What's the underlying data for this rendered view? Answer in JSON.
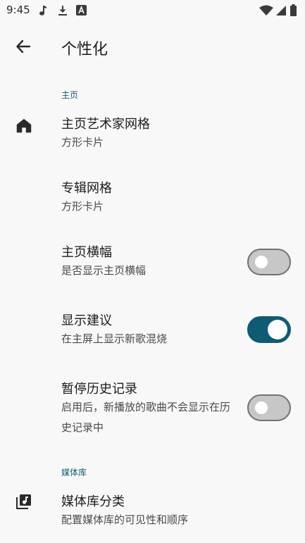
{
  "status_bar": {
    "time": "9:45",
    "icons": [
      "music-note-icon",
      "download-icon",
      "text-a-icon",
      "wifi-icon",
      "signal-icon",
      "battery-icon"
    ]
  },
  "header": {
    "title": "个性化",
    "back_icon": "arrow-back-icon"
  },
  "sections": {
    "home": {
      "label": "主页",
      "artist_grid": {
        "title": "主页艺术家网格",
        "subtitle": "方形卡片",
        "icon": "home-icon"
      },
      "album_grid": {
        "title": "专辑网格",
        "subtitle": "方形卡片"
      },
      "home_banner": {
        "title": "主页横幅",
        "subtitle": "是否显示主页横幅",
        "enabled": false
      },
      "suggestions": {
        "title": "显示建议",
        "subtitle": "在主屏上显示新歌混烧",
        "enabled": true
      },
      "pause_history": {
        "title": "暂停历史记录",
        "subtitle": "启用后，新播放的歌曲不会显示在历史记录中",
        "enabled": false
      }
    },
    "library": {
      "label": "媒体库",
      "categories": {
        "title": "媒体库分类",
        "subtitle": "配置媒体库的可见性和顺序",
        "icon": "library-music-icon"
      }
    }
  },
  "colors": {
    "accent": "#0d5c73",
    "background": "#f8f8f8",
    "switch_off_track": "#c7c7c7"
  }
}
